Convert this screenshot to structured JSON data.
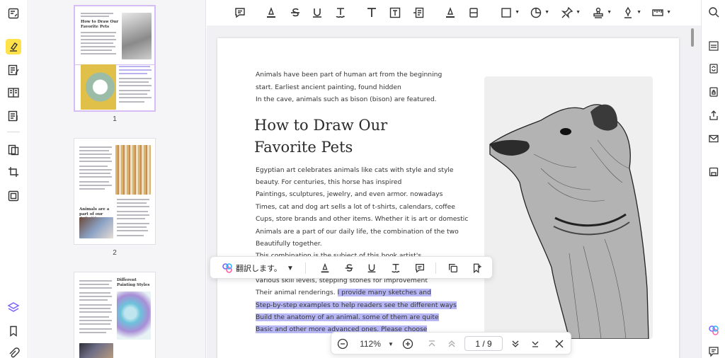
{
  "thumbnails": {
    "pages": [
      {
        "number": "1",
        "title": "How to Draw Our Favorite Pets"
      },
      {
        "number": "2",
        "title": "Animals are a part of our daily life"
      },
      {
        "number": "",
        "title": "Different Painting Styles"
      }
    ]
  },
  "document": {
    "intro_lines": [
      "Animals have been part of human art from the beginning",
      "start. Earliest ancient painting, found hidden",
      "In the cave, animals such as bison (bison) are featured."
    ],
    "title_lines": [
      "How to Draw Our",
      "Favorite Pets"
    ],
    "body_lines": [
      "Egyptian art celebrates animals like cats with style and style",
      "beauty. For centuries, this horse has inspired",
      "Paintings, sculptures, jewelry, and even armor. nowadays",
      "Times, cat and dog art sells a lot of t-shirts, calendars, coffee",
      "Cups, store brands and other items. Whether it is art or domestic",
      "Animals are a part of our daily life, the combination of the two",
      "Beautifully together.",
      "This combination is the subject of this book artist's"
    ],
    "skills_line": "various skill levels, stepping stones for improvement",
    "renderings_prefix": "Their animal renderings.",
    "highlighted_lines": [
      "I provide many sketches and",
      "Step-by-step examples to help readers see the different ways",
      "Build the anatomy of an animal. some of them are quite",
      "Basic and other more advanced ones. Please choose"
    ],
    "highlight_color": "#b7b6f5"
  },
  "selection_toolbar": {
    "translate_label": "翻訳します。"
  },
  "page_nav": {
    "zoom": "112%",
    "page_indicator": "1  /  9"
  },
  "colors": {
    "active_tool": "#ffe14a",
    "selected_thumb_border": "#d6bdf6",
    "accent_purple": "#7b61ff"
  }
}
